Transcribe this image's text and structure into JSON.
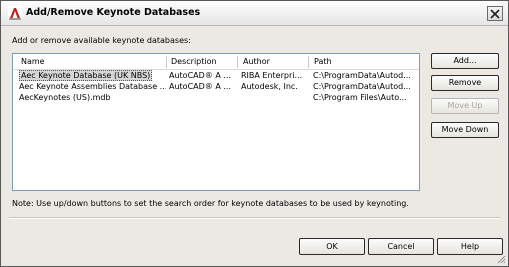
{
  "window": {
    "title": "Add/Remove Keynote Databases"
  },
  "description": "Add or remove available keynote databases:",
  "list": {
    "columns": [
      "Name",
      "Description",
      "Author",
      "Path"
    ],
    "rows": [
      {
        "name": "Aec Keynote Database (UK NBS)",
        "description": "AutoCAD® A ...",
        "author": "RIBA Enterpri...",
        "path": "C:\\ProgramData\\Autod..."
      },
      {
        "name": "Aec Keynote Assemblies Database ...",
        "description": "AutoCAD® A ...",
        "author": "Autodesk, Inc.",
        "path": "C:\\ProgramData\\Autod..."
      },
      {
        "name": "AecKeynotes (US).mdb",
        "description": "",
        "author": "",
        "path": "C:\\Program Files\\Auto..."
      }
    ]
  },
  "buttons": {
    "add": "Add...",
    "remove": "Remove",
    "move_up": "Move Up",
    "move_down": "Move Down",
    "ok": "OK",
    "cancel": "Cancel",
    "help": "Help"
  },
  "note": "Note: Use up/down buttons to set the search order for keynote databases to be used by keynoting.",
  "icons": {
    "app": "autocad-icon",
    "close": "close-icon",
    "resize": "resize-grip-icon"
  }
}
